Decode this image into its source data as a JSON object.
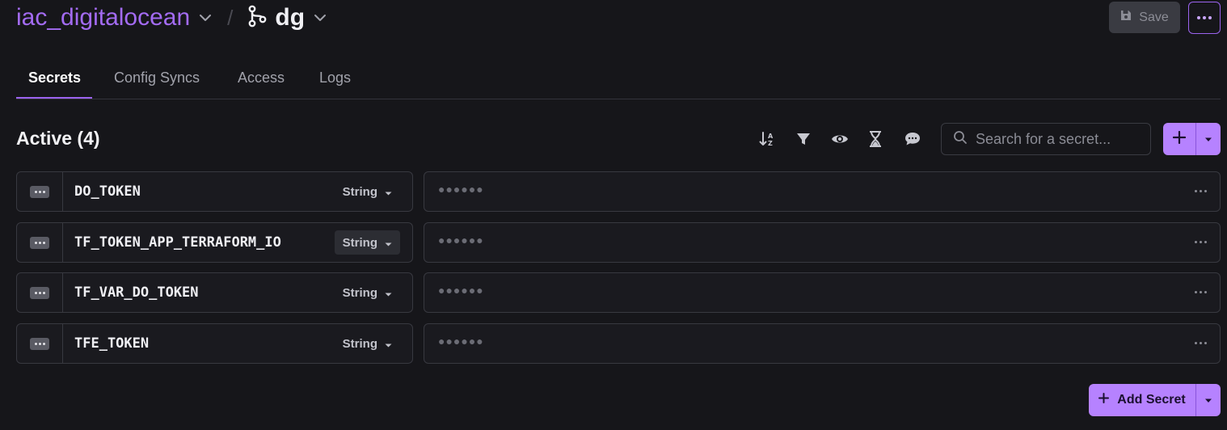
{
  "header": {
    "project_name": "iac_digitalocean",
    "separator": "/",
    "branch_name": "dg",
    "save_label": "Save"
  },
  "tabs": [
    {
      "label": "Secrets"
    },
    {
      "label": "Config Syncs"
    },
    {
      "label": "Access"
    },
    {
      "label": "Logs"
    }
  ],
  "section": {
    "title": "Active (4)"
  },
  "toolbar": {
    "icons": [
      "sort-icon",
      "filter-icon",
      "eye-icon",
      "hourglass-icon",
      "comment-icon"
    ]
  },
  "search": {
    "placeholder": "Search for a secret..."
  },
  "secrets": [
    {
      "key": "DO_TOKEN",
      "type": "String",
      "value_mask": "●●●●●●"
    },
    {
      "key": "TF_TOKEN_APP_TERRAFORM_IO",
      "type": "String",
      "value_mask": "●●●●●●"
    },
    {
      "key": "TF_VAR_DO_TOKEN",
      "type": "String",
      "value_mask": "●●●●●●"
    },
    {
      "key": "TFE_TOKEN",
      "type": "String",
      "value_mask": "●●●●●●"
    }
  ],
  "footer": {
    "add_secret_label": "Add Secret"
  },
  "colors": {
    "accent": "#b682ff",
    "project_text": "#a36bf2",
    "background": "#16161a"
  }
}
